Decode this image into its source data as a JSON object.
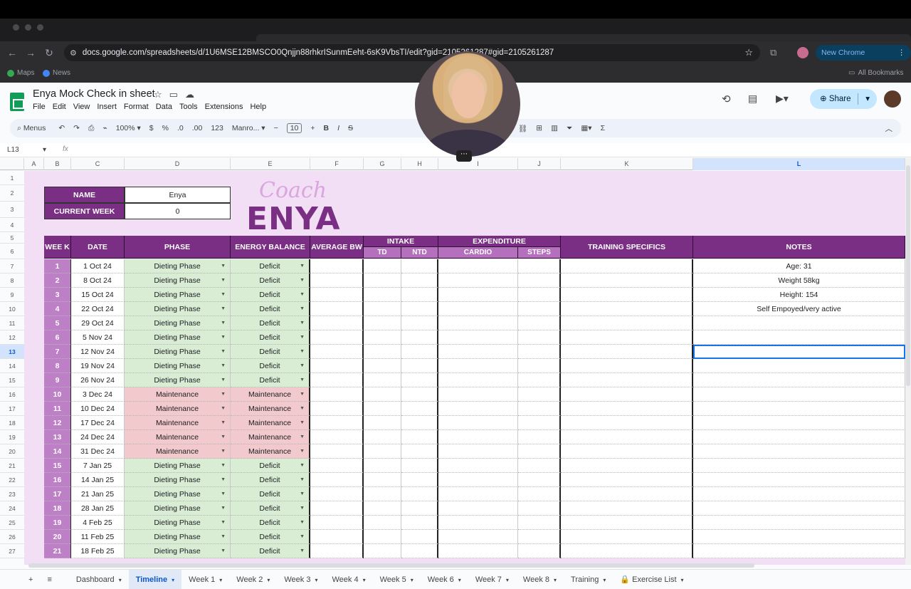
{
  "browser": {
    "url": "docs.google.com/spreadsheets/d/1U6MSE12BMSCO0Qnjjn88rhkrISunmEeht-6sK9VbsTI/edit?gid=2105261287#gid=2105261287",
    "new_chrome": "New Chrome available",
    "bookmarks": [
      {
        "label": "Maps",
        "color": "#34a853"
      },
      {
        "label": "News",
        "color": "#4285f4"
      }
    ],
    "all_bookmarks": "All Bookmarks"
  },
  "sheets": {
    "title": "Enya Mock Check in sheet",
    "menu": [
      "File",
      "Edit",
      "View",
      "Insert",
      "Format",
      "Data",
      "Tools",
      "Extensions",
      "Help"
    ],
    "share": "Share",
    "toolbar": {
      "menus": "Menus",
      "zoom": "100%",
      "currency": "$",
      "percent": "%",
      "dec_less": ".0",
      "dec_more": ".00",
      "number": "123",
      "font": "Manro...",
      "font_size": "10"
    },
    "name_box": "L13",
    "fx": "fx"
  },
  "columns": [
    {
      "id": "A",
      "w": 28
    },
    {
      "id": "B",
      "w": 38
    },
    {
      "id": "C",
      "w": 75
    },
    {
      "id": "D",
      "w": 149
    },
    {
      "id": "E",
      "w": 112
    },
    {
      "id": "F",
      "w": 75
    },
    {
      "id": "G",
      "w": 53
    },
    {
      "id": "H",
      "w": 52
    },
    {
      "id": "I",
      "w": 112
    },
    {
      "id": "J",
      "w": 60
    },
    {
      "id": "K",
      "w": 186
    },
    {
      "id": "L",
      "w": 298
    }
  ],
  "selected_col": "L",
  "selected_row": "13",
  "info": {
    "name_label": "NAME",
    "name_value": "Enya",
    "week_label": "CURRENT WEEK",
    "week_value": "0"
  },
  "brand": {
    "script": "Coach",
    "word": "ENYA"
  },
  "headers": {
    "week": "WEE K",
    "date": "DATE",
    "phase": "PHASE",
    "energy": "ENERGY BALANCE",
    "avg_bw": "AVERAGE BW",
    "intake": "INTAKE",
    "td": "TD",
    "ntd": "NTD",
    "expenditure": "EXPENDITURE",
    "cardio": "CARDIO",
    "steps": "STEPS",
    "training": "TRAINING SPECIFICS",
    "notes": "NOTES"
  },
  "rows": [
    {
      "week": "1",
      "date": "1 Oct 24",
      "phase": "Dieting Phase",
      "energy": "Deficit",
      "note": "Age: 31"
    },
    {
      "week": "2",
      "date": "8 Oct 24",
      "phase": "Dieting Phase",
      "energy": "Deficit",
      "note": "Weight 58kg"
    },
    {
      "week": "3",
      "date": "15 Oct 24",
      "phase": "Dieting Phase",
      "energy": "Deficit",
      "note": "Height: 154"
    },
    {
      "week": "4",
      "date": "22 Oct 24",
      "phase": "Dieting Phase",
      "energy": "Deficit",
      "note": "Self Empoyed/very active"
    },
    {
      "week": "5",
      "date": "29 Oct 24",
      "phase": "Dieting Phase",
      "energy": "Deficit",
      "note": ""
    },
    {
      "week": "6",
      "date": "5 Nov 24",
      "phase": "Dieting Phase",
      "energy": "Deficit",
      "note": ""
    },
    {
      "week": "7",
      "date": "12 Nov 24",
      "phase": "Dieting Phase",
      "energy": "Deficit",
      "note": ""
    },
    {
      "week": "8",
      "date": "19 Nov 24",
      "phase": "Dieting Phase",
      "energy": "Deficit",
      "note": ""
    },
    {
      "week": "9",
      "date": "26 Nov 24",
      "phase": "Dieting Phase",
      "energy": "Deficit",
      "note": ""
    },
    {
      "week": "10",
      "date": "3 Dec 24",
      "phase": "Maintenance",
      "energy": "Maintenance",
      "note": ""
    },
    {
      "week": "11",
      "date": "10 Dec 24",
      "phase": "Maintenance",
      "energy": "Maintenance",
      "note": ""
    },
    {
      "week": "12",
      "date": "17 Dec 24",
      "phase": "Maintenance",
      "energy": "Maintenance",
      "note": ""
    },
    {
      "week": "13",
      "date": "24 Dec 24",
      "phase": "Maintenance",
      "energy": "Maintenance",
      "note": ""
    },
    {
      "week": "14",
      "date": "31 Dec 24",
      "phase": "Maintenance",
      "energy": "Maintenance",
      "note": ""
    },
    {
      "week": "15",
      "date": "7 Jan 25",
      "phase": "Dieting Phase",
      "energy": "Deficit",
      "note": ""
    },
    {
      "week": "16",
      "date": "14 Jan 25",
      "phase": "Dieting Phase",
      "energy": "Deficit",
      "note": ""
    },
    {
      "week": "17",
      "date": "21 Jan 25",
      "phase": "Dieting Phase",
      "energy": "Deficit",
      "note": ""
    },
    {
      "week": "18",
      "date": "28 Jan 25",
      "phase": "Dieting Phase",
      "energy": "Deficit",
      "note": ""
    },
    {
      "week": "19",
      "date": "4 Feb 25",
      "phase": "Dieting Phase",
      "energy": "Deficit",
      "note": ""
    },
    {
      "week": "20",
      "date": "11 Feb 25",
      "phase": "Dieting Phase",
      "energy": "Deficit",
      "note": ""
    },
    {
      "week": "21",
      "date": "18 Feb 25",
      "phase": "Dieting Phase",
      "energy": "Deficit",
      "note": ""
    }
  ],
  "row_numbers": [
    "1",
    "2",
    "3",
    "4",
    "5",
    "6",
    "7",
    "8",
    "9",
    "10",
    "11",
    "12",
    "13",
    "14",
    "15",
    "16",
    "17",
    "18",
    "19",
    "20",
    "21",
    "22",
    "23",
    "24",
    "25",
    "26",
    "27"
  ],
  "tabs": [
    {
      "label": "Dashboard",
      "active": false,
      "lock": false
    },
    {
      "label": "Timeline",
      "active": true,
      "lock": false
    },
    {
      "label": "Week 1",
      "active": false,
      "lock": false
    },
    {
      "label": "Week 2",
      "active": false,
      "lock": false
    },
    {
      "label": "Week 3",
      "active": false,
      "lock": false
    },
    {
      "label": "Week 4",
      "active": false,
      "lock": false
    },
    {
      "label": "Week 5",
      "active": false,
      "lock": false
    },
    {
      "label": "Week 6",
      "active": false,
      "lock": false
    },
    {
      "label": "Week 7",
      "active": false,
      "lock": false
    },
    {
      "label": "Week 8",
      "active": false,
      "lock": false
    },
    {
      "label": "Training",
      "active": false,
      "lock": false
    },
    {
      "label": "Exercise List",
      "active": false,
      "lock": true
    }
  ],
  "colors": {
    "header_purple": "#7a2f85",
    "week_cell": "#bd7fc5",
    "diet_green": "#d9ecd4",
    "maint_red": "#f2c9cc",
    "canvas_bg": "#f2def5"
  }
}
